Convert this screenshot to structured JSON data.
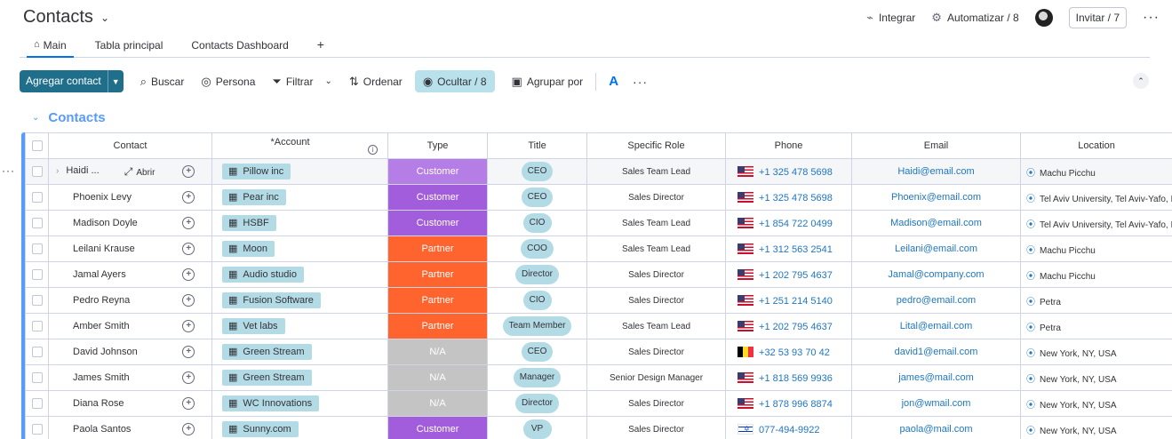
{
  "header": {
    "title": "Contacts",
    "integrate": "Integrar",
    "automate": "Automatizar / 8",
    "invite": "Invitar / 7"
  },
  "tabs": [
    {
      "label": "Main"
    },
    {
      "label": "Tabla principal"
    },
    {
      "label": "Contacts Dashboard"
    },
    {
      "label": "+"
    }
  ],
  "toolbar": {
    "add": "Agregar contact",
    "search": "Buscar",
    "person": "Persona",
    "filter": "Filtrar",
    "sort": "Ordenar",
    "hide": "Ocultar / 8",
    "group": "Agrupar por"
  },
  "group": {
    "name": "Contacts"
  },
  "columns": {
    "contact": "Contact",
    "account": "*Account",
    "type": "Type",
    "title": "Title",
    "role": "Specific Role",
    "phone": "Phone",
    "email": "Email",
    "location": "Location"
  },
  "open_label": "Abrir",
  "colors": {
    "customer": "#a25ddc",
    "customer_light": "#b57de6",
    "partner": "#ff642e",
    "na": "#c4c4c4",
    "group": "#579bfc"
  },
  "rows": [
    {
      "contact": "Haidi ...",
      "account": "Pillow inc",
      "type": "Customer",
      "type_color": "#b57de6",
      "title": "CEO",
      "role": "Sales Team Lead",
      "flag": "us",
      "phone": "+1 325 478 5698",
      "email": "Haidi@email.com",
      "location": "Machu Picchu"
    },
    {
      "contact": "Phoenix Levy",
      "account": "Pear inc",
      "type": "Customer",
      "type_color": "#a25ddc",
      "title": "CEO",
      "role": "Sales Director",
      "flag": "us",
      "phone": "+1 325 478 5698",
      "email": "Phoenix@email.com",
      "location": "Tel Aviv University, Tel Aviv-Yafo, Is"
    },
    {
      "contact": "Madison Doyle",
      "account": "HSBF",
      "type": "Customer",
      "type_color": "#a25ddc",
      "title": "CIO",
      "role": "Sales Team Lead",
      "flag": "us",
      "phone": "+1 854 722 0499",
      "email": "Madison@email.com",
      "location": "Tel Aviv University, Tel Aviv-Yafo, Is"
    },
    {
      "contact": "Leilani Krause",
      "account": "Moon",
      "type": "Partner",
      "type_color": "#ff642e",
      "title": "COO",
      "role": "Sales Team Lead",
      "flag": "us",
      "phone": "+1 312 563 2541",
      "email": "Leilani@email.com",
      "location": "Machu Picchu"
    },
    {
      "contact": "Jamal Ayers",
      "account": "Audio studio",
      "type": "Partner",
      "type_color": "#ff642e",
      "title": "Director",
      "role": "Sales Director",
      "flag": "us",
      "phone": "+1 202 795 4637",
      "email": "Jamal@company.com",
      "location": "Machu Picchu"
    },
    {
      "contact": "Pedro Reyna",
      "account": "Fusion Software",
      "type": "Partner",
      "type_color": "#ff642e",
      "title": "CIO",
      "role": "Sales Director",
      "flag": "us",
      "phone": "+1 251 214 5140",
      "email": "pedro@email.com",
      "location": "Petra"
    },
    {
      "contact": "Amber Smith",
      "account": "Vet labs",
      "type": "Partner",
      "type_color": "#ff642e",
      "title": "Team Member",
      "role": "Sales Team Lead",
      "flag": "us",
      "phone": "+1 202 795 4637",
      "email": "Lital@email.com",
      "location": "Petra"
    },
    {
      "contact": "David Johnson",
      "account": "Green Stream",
      "type": "N/A",
      "type_color": "#c4c4c4",
      "title": "CEO",
      "role": "Sales Director",
      "flag": "be",
      "phone": "+32 53 93 70 42",
      "email": "david1@email.com",
      "location": "New York, NY, USA"
    },
    {
      "contact": "James Smith",
      "account": "Green Stream",
      "type": "N/A",
      "type_color": "#c4c4c4",
      "title": "Manager",
      "role": "Senior Design Manager",
      "flag": "us",
      "phone": "+1 818 569 9936",
      "email": "james@mail.com",
      "location": "New York, NY, USA"
    },
    {
      "contact": "Diana Rose",
      "account": "WC Innovations",
      "type": "N/A",
      "type_color": "#c4c4c4",
      "title": "Director",
      "role": "Sales Director",
      "flag": "us",
      "phone": "+1 878 996 8874",
      "email": "jon@wmail.com",
      "location": "New York, NY, USA"
    },
    {
      "contact": "Paola Santos",
      "account": "Sunny.com",
      "type": "Customer",
      "type_color": "#a25ddc",
      "title": "VP",
      "role": "Sales Director",
      "flag": "il",
      "phone": "077-494-9922",
      "email": "paola@mail.com",
      "location": "New York, NY, USA"
    }
  ]
}
